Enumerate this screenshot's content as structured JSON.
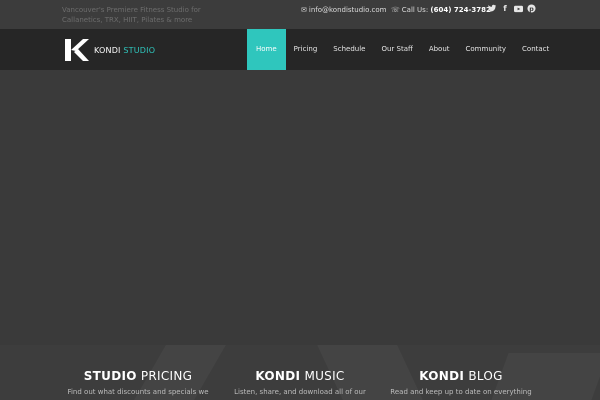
{
  "topbar": {
    "tagline": "Vancouver's Premiere Fitness Studio for Callanetics, TRX, HIIT, Pilates & more",
    "email": "info@kondistudio.com",
    "phone_label": "Call Us:",
    "phone_number": "(604) 724-3782",
    "social_icons": [
      "twitter-icon",
      "facebook-icon",
      "youtube-icon",
      "pinterest-icon"
    ]
  },
  "brand": {
    "name_main": "KONDI",
    "name_accent": "STUDIO",
    "accent_color": "#2fc6bd"
  },
  "nav": {
    "items": [
      "Home",
      "Pricing",
      "Schedule",
      "Our Staff",
      "About",
      "Community",
      "Contact"
    ],
    "active": "Home"
  },
  "features": [
    {
      "title_bold": "STUDIO",
      "title_rest": "PRICING",
      "desc": "Find out what discounts and specials we"
    },
    {
      "title_bold": "KONDI",
      "title_rest": "MUSIC",
      "desc": "Listen, share, and download all of our"
    },
    {
      "title_bold": "KONDI",
      "title_rest": "BLOG",
      "desc": "Read and keep up to date on everything"
    }
  ]
}
